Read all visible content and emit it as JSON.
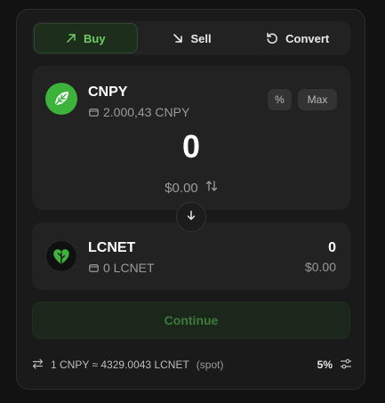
{
  "tabs": [
    {
      "label": "Buy",
      "icon": "arrow-up-right-icon",
      "active": true
    },
    {
      "label": "Sell",
      "icon": "arrow-down-right-icon",
      "active": false
    },
    {
      "label": "Convert",
      "icon": "rotate-ccw-icon",
      "active": false
    }
  ],
  "from": {
    "symbol": "CNPY",
    "balance": "2.000,43 CNPY",
    "amount": "0",
    "fiat": "$0.00",
    "percent_label": "%",
    "max_label": "Max"
  },
  "to": {
    "symbol": "LCNET",
    "balance": "0 LCNET",
    "amount": "0",
    "fiat": "$0.00"
  },
  "action": {
    "continue_label": "Continue"
  },
  "footer": {
    "rate": "1 CNPY ≈ 4329.0043 LCNET",
    "rate_note": "(spot)",
    "slippage": "5%"
  },
  "colors": {
    "accent": "#6fce63",
    "cnpy_logo": "#3cb33a",
    "panel": "#1a1a1a",
    "card": "#222222"
  }
}
